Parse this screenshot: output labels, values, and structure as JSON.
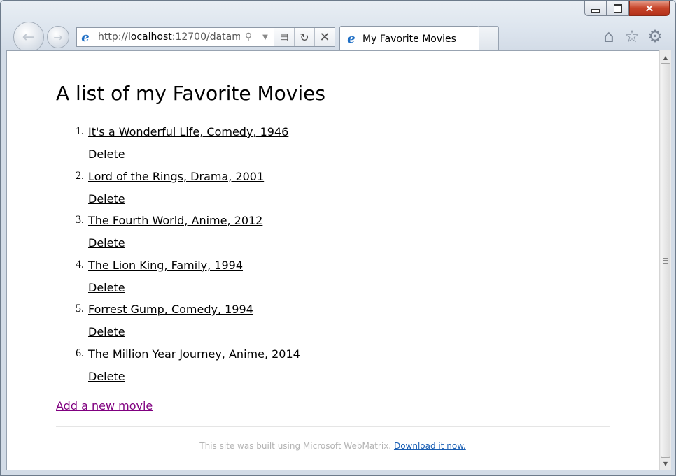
{
  "browser": {
    "url_prefix": "http://",
    "url_host": "localhost",
    "url_rest": ":12700/datam",
    "tab_title": "My Favorite Movies",
    "window_controls": {
      "minimize": "minimize",
      "maximize": "maximize",
      "close": "×"
    },
    "toolbar_icons": [
      "home-icon",
      "favorites-star-icon",
      "tools-gear-icon"
    ]
  },
  "page": {
    "title": "A list of my Favorite Movies",
    "movies": [
      {
        "number": "1.",
        "label": "It's a Wonderful Life, Comedy, 1946",
        "delete": "Delete"
      },
      {
        "number": "2.",
        "label": "Lord of the Rings, Drama, 2001",
        "delete": "Delete"
      },
      {
        "number": "3.",
        "label": "The Fourth World, Anime, 2012",
        "delete": "Delete"
      },
      {
        "number": "4.",
        "label": "The Lion King, Family, 1994",
        "delete": "Delete"
      },
      {
        "number": "5.",
        "label": "Forrest Gump, Comedy, 1994",
        "delete": "Delete"
      },
      {
        "number": "6.",
        "label": "The Million Year Journey, Anime, 2014",
        "delete": "Delete"
      }
    ],
    "add_link": "Add a new movie",
    "footer_text": "This site was built using Microsoft WebMatrix.",
    "footer_link": "Download it now."
  },
  "colors": {
    "visited_link": "#800080",
    "footer_link": "#1a5fb4",
    "footer_text": "#b3b3b3"
  }
}
